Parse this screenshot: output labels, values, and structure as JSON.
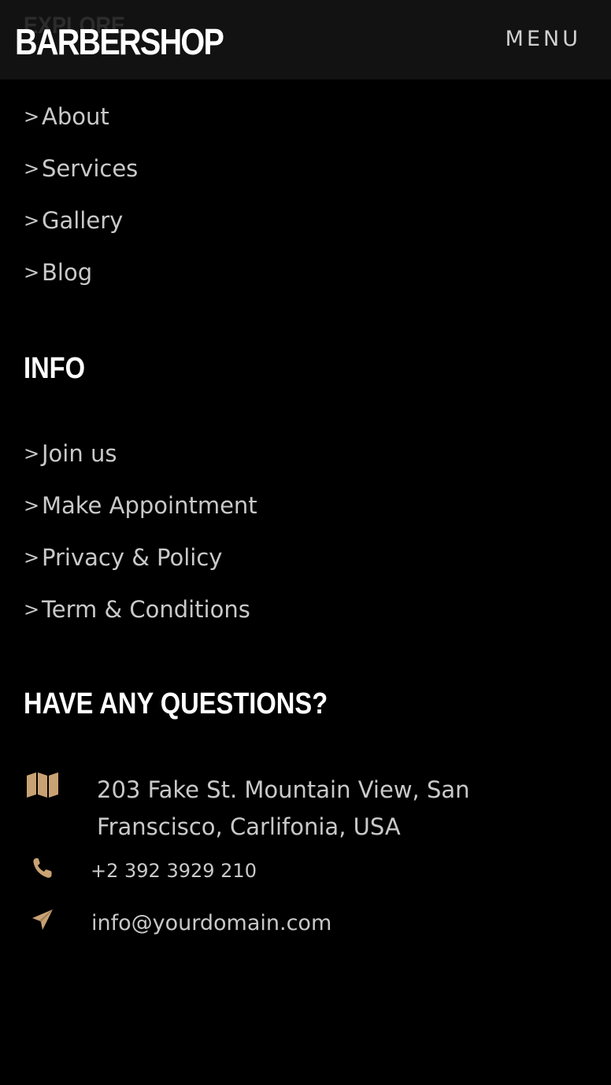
{
  "header": {
    "ghost_heading": "EXPLORE",
    "brand": "BARBERSHOP",
    "menu_label": "MENU"
  },
  "explore": {
    "items": [
      {
        "label": "About"
      },
      {
        "label": "Services"
      },
      {
        "label": "Gallery"
      },
      {
        "label": "Blog"
      }
    ]
  },
  "info": {
    "title": "INFO",
    "items": [
      {
        "label": "Join us"
      },
      {
        "label": "Make Appointment"
      },
      {
        "label": "Privacy & Policy"
      },
      {
        "label": "Term & Conditions"
      }
    ]
  },
  "contact": {
    "title": "HAVE ANY QUESTIONS?",
    "address": "203 Fake St. Mountain View, San Franscisco, Carlifonia, USA",
    "phone": "+2 392 3929 210",
    "email": "info@yourdomain.com",
    "icons": {
      "address": "map-icon",
      "phone": "phone-icon",
      "email": "paper-plane-icon"
    }
  },
  "colors": {
    "background": "#000000",
    "header_bg": "#121212",
    "accent": "#c9a273",
    "text": "#c9c9c9",
    "heading": "#ffffff"
  }
}
